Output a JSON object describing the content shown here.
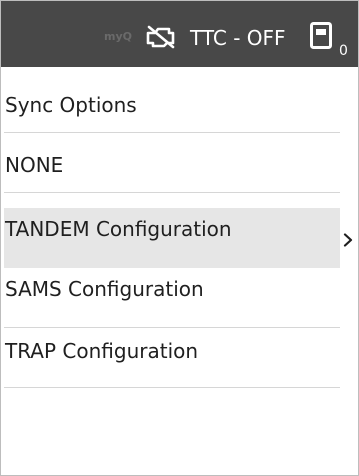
{
  "status_bar": {
    "myq_label": "myQ",
    "link_icon": "no-link-icon",
    "ttc_status": "TTC - OFF",
    "device_icon": "device-icon",
    "device_count": "0"
  },
  "menu": {
    "items": [
      {
        "label": "Sync Options",
        "selected": false
      },
      {
        "label": "NONE",
        "selected": false
      },
      {
        "label": "TANDEM Configuration",
        "selected": true
      },
      {
        "label": "SAMS Configuration",
        "selected": false
      },
      {
        "label": "TRAP Configuration",
        "selected": false
      }
    ]
  },
  "colors": {
    "status_bar_bg": "#484848",
    "selected_row_bg": "#e6e6e6",
    "divider": "#d6d6d6",
    "text": "#1f1f1f"
  }
}
